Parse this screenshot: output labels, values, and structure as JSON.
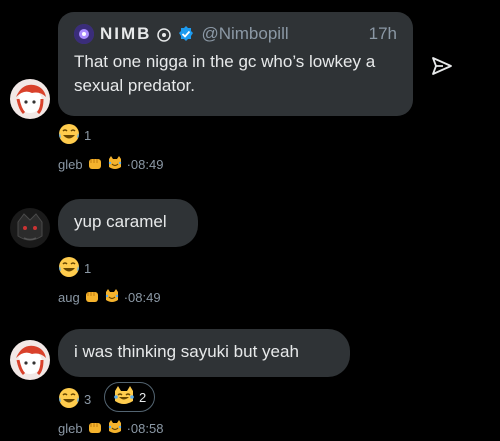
{
  "quoted_post": {
    "name": "NIMB",
    "handle": "@Nimbopill",
    "time": "17h",
    "text": "That one nigga in the gc who’s lowkey a sexual predator."
  },
  "messages": [
    {
      "sender": "gleb",
      "reaction_count": "1",
      "time": "08:49"
    },
    {
      "sender": "aug",
      "text": "yup caramel",
      "reaction_count": "1",
      "time": "08:49"
    },
    {
      "sender": "gleb",
      "text": "i was thinking sayuki but yeah",
      "reaction_count_a": "3",
      "reaction_count_b": "2",
      "time": "08:58"
    }
  ],
  "separator": "·",
  "colors": {
    "background": "#000000",
    "bubble": "#2f3336",
    "muted_text": "#8b98a5",
    "verified_blue": "#1d9bf0"
  },
  "icons": {
    "share": "send-icon",
    "verified": "verified-badge-icon",
    "reaction": "laughing-tears-emoji",
    "fist": "fist-emoji",
    "cat": "cat-joy-emoji"
  }
}
